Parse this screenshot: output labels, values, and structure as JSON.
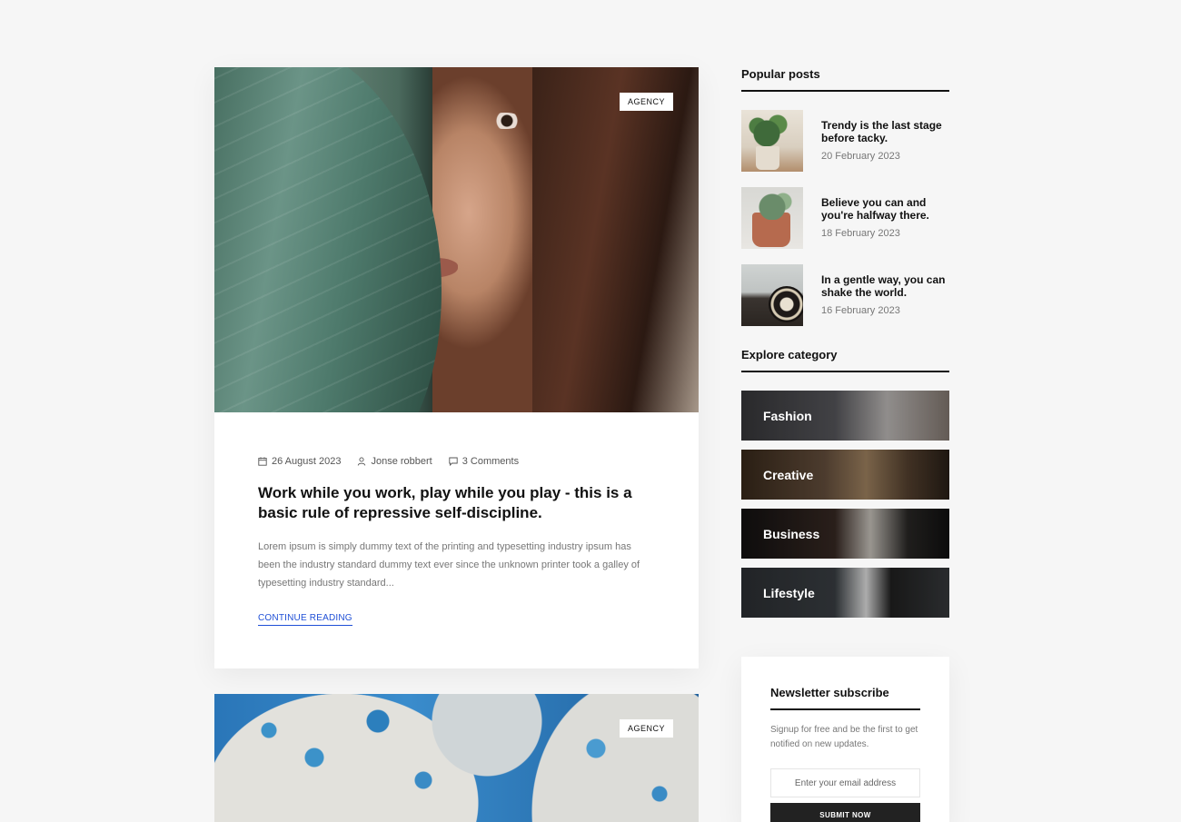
{
  "post1": {
    "tag": "AGENCY",
    "date": "26 August 2023",
    "author": "Jonse robbert",
    "comments": "3 Comments",
    "title": "Work while you work, play while you play - this is a basic rule of repressive self-discipline.",
    "excerpt": "Lorem ipsum is simply dummy text of the printing and typesetting industry ipsum has been the industry standard dummy text ever since the unknown printer took a galley of typesetting industry standard...",
    "cta": "CONTINUE READING"
  },
  "post2": {
    "tag": "AGENCY"
  },
  "popular": {
    "title": "Popular posts",
    "items": [
      {
        "title": "Trendy is the last stage before tacky.",
        "date": "20 February 2023"
      },
      {
        "title": "Believe you can and you're halfway there.",
        "date": "18 February 2023"
      },
      {
        "title": "In a gentle way, you can shake the world.",
        "date": "16 February 2023"
      }
    ]
  },
  "categories": {
    "title": "Explore category",
    "items": [
      "Fashion",
      "Creative",
      "Business",
      "Lifestyle"
    ]
  },
  "newsletter": {
    "title": "Newsletter subscribe",
    "text": "Signup for free and be the first to get notified on new updates.",
    "placeholder": "Enter your email address",
    "button": "SUBMIT NOW"
  },
  "colors": {
    "link": "#1f4fd6",
    "dark": "#222222",
    "background": "#f6f6f6"
  }
}
